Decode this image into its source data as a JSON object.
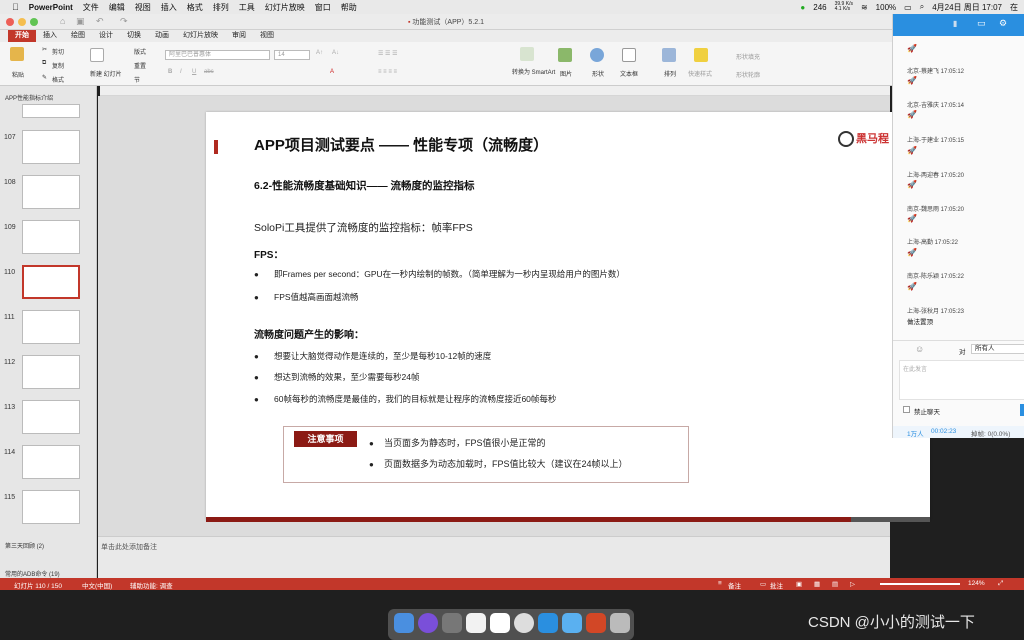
{
  "menubar": {
    "app_name": "PowerPoint",
    "items": [
      "文件",
      "编辑",
      "视图",
      "插入",
      "格式",
      "排列",
      "工具",
      "幻灯片放映",
      "窗口",
      "帮助"
    ],
    "status_246": "246",
    "net_up": "39.9 K/s",
    "net_down": "4.1 K/s",
    "battery": "100%",
    "date_time": "4月24日 周日 17:07",
    "input_method": "在"
  },
  "window": {
    "title": "功能测试（APP）5.2.1"
  },
  "ribbon": {
    "tabs": [
      "开始",
      "插入",
      "绘图",
      "设计",
      "切换",
      "动画",
      "幻灯片放映",
      "审阅",
      "视图"
    ],
    "active_tab": "开始",
    "paste_label": "粘贴",
    "cut_label": "剪切",
    "copy_label": "复制",
    "format_label": "格式",
    "new_slide_label": "新建\n幻灯片",
    "layout_label": "版式",
    "reset_label": "重置",
    "section_label": "节",
    "font_name": "阿里巴巴普惠体",
    "font_size": "14",
    "convert_smartart_label": "转换为\nSmartArt",
    "picture_label": "图片",
    "shape_label": "形状",
    "textbox_label": "文本框",
    "arrange_label": "排列",
    "quick_styles_label": "快速样式",
    "shape_fill_label": "形状填充",
    "shape_outline_label": "形状轮廓"
  },
  "sidebar": {
    "section_top": "APP性能指标介绍",
    "slides": [
      {
        "num": "107"
      },
      {
        "num": "108"
      },
      {
        "num": "109"
      },
      {
        "num": "110"
      },
      {
        "num": "111"
      },
      {
        "num": "112"
      },
      {
        "num": "113"
      },
      {
        "num": "114"
      },
      {
        "num": "115"
      }
    ],
    "section_3": "第三天回顾 (2)",
    "section_adb": "常用的ADB命令 (19)"
  },
  "slide": {
    "title": "APP项目测试要点 —— 性能专项（流畅度）",
    "logo_text": "黑马程",
    "subtitle": "6.2-性能流畅度基础知识—— 流畅度的监控指标",
    "intro": "SoloPi工具提供了流畅度的监控指标：帧率FPS",
    "fps_head": "FPS：",
    "fps_bullets": [
      "即Frames per second：GPU在一秒内绘制的帧数。（简单理解为一秒内呈现给用户的图片数）",
      "FPS值越高画面越流畅"
    ],
    "impact_head": "流畅度问题产生的影响：",
    "impact_bullets": [
      "想要让大脑觉得动作是连续的，至少是每秒10-12帧的速度",
      "想达到流畅的效果，至少需要每秒24帧",
      "60帧每秒的流畅度是最佳的，我们的目标就是让程序的流畅度接近60帧每秒"
    ],
    "note_label": "注意事项",
    "note_lines": [
      "当页面多为静态时，FPS值很小是正常的",
      "页面数据多为动态加载时，FPS值比较大（建议在24帧以上）"
    ],
    "bullet_char": "●"
  },
  "notes": {
    "placeholder": "单击此处添加备注"
  },
  "statusbar": {
    "slide_info": "幻灯片 110 / 150",
    "language": "中文(中国)",
    "accessibility": "辅助功能: 调查",
    "notes_label": "备注",
    "comments_label": "批注",
    "zoom": "124%"
  },
  "chat": {
    "entries": [
      {
        "name": "北京-蔡建飞 17:05:12",
        "msg": ""
      },
      {
        "name": "北京-吉雅庆 17:05:14",
        "msg": ""
      },
      {
        "name": "上海-于建业 17:05:15",
        "msg": ""
      },
      {
        "name": "上海-两迎春 17:05:20",
        "msg": ""
      },
      {
        "name": "南京-魏思雨 17:05:20",
        "msg": ""
      },
      {
        "name": "上海-高勤 17:05:22",
        "msg": ""
      },
      {
        "name": "南京-陈乐颖 17:05:22",
        "msg": ""
      },
      {
        "name": "上海-张秋月 17:05:23",
        "msg": "做法置顶"
      }
    ],
    "rocket": "🚀",
    "to_label": "对",
    "to_value": "所有人",
    "input_placeholder": "在此发言",
    "mute_label": "禁止聊天",
    "online_count": "1万人",
    "elapsed": "00:02:23",
    "dropped": "掉帧: 0(0.0%)"
  },
  "watermark": "CSDN @小小的测试一下",
  "colors": {
    "accent_red": "#c2372a",
    "dark_red": "#8b1a14",
    "chat_blue": "#2a8fe0"
  }
}
